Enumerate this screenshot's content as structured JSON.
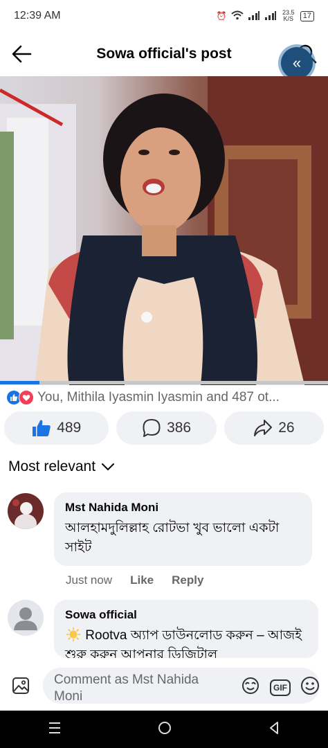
{
  "status": {
    "time": "12:39 AM",
    "net_speed": "23.5 K/S",
    "battery": "17"
  },
  "header": {
    "title": "Sowa official's post"
  },
  "video": {
    "progress": 0.12
  },
  "reactions": {
    "text": "You, Mithila Iyasmin Iyasmin and 487 ot..."
  },
  "actions": {
    "likes": "489",
    "comments": "386",
    "shares": "26"
  },
  "sort": {
    "label": "Most relevant"
  },
  "comments": [
    {
      "author": "Mst Nahida Moni",
      "text": "আলহামদুলিল্লাহ রোটভা খুব ভালো একটা সাইট",
      "time": "Just now",
      "like_label": "Like",
      "reply_label": "Reply"
    },
    {
      "author": "Sowa official",
      "text": "Rootva অ্যাপ ডাউনলোড করুন – আজই শুরু করুন আপনার ডিজিটাল"
    }
  ],
  "composer": {
    "placeholder": "Comment as Mst Nahida Moni",
    "gif_label": "GIF"
  },
  "colors": {
    "accent": "#1b74e4",
    "love": "#f33e58",
    "bubble": "#eff1f5"
  }
}
